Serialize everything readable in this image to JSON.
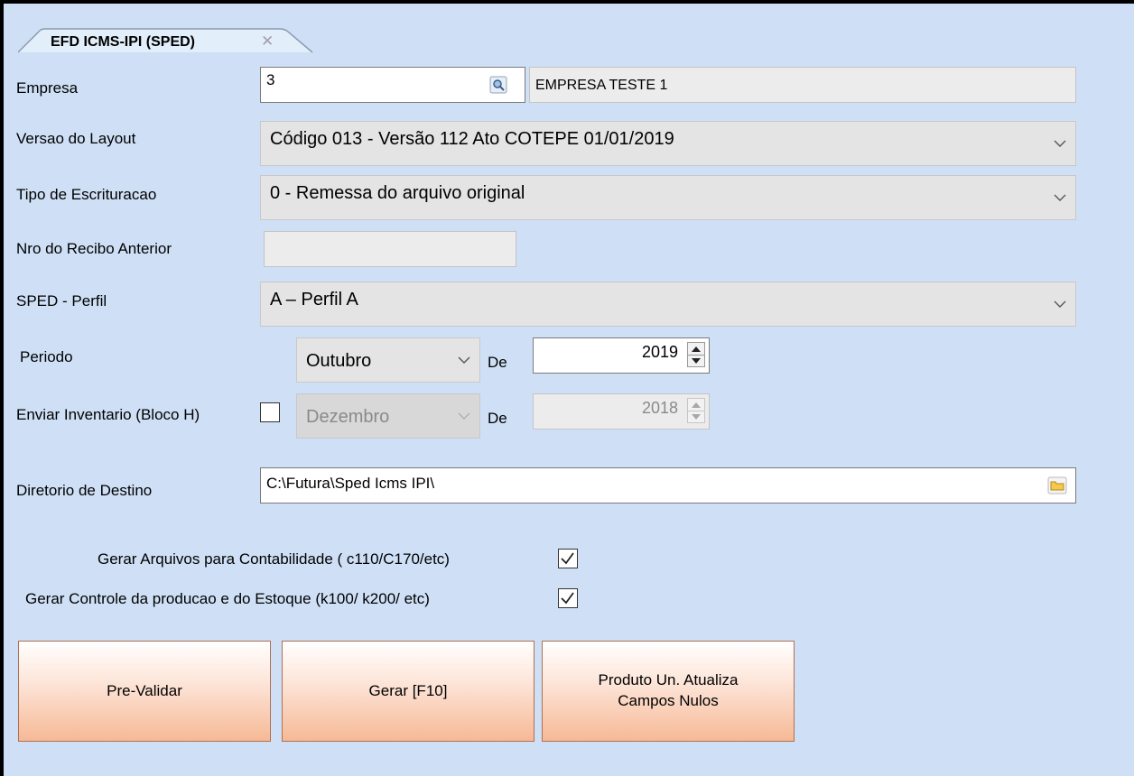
{
  "tab": {
    "title": "EFD ICMS-IPI (SPED)",
    "close": "✕"
  },
  "form": {
    "empresa": {
      "label": "Empresa",
      "code": "3",
      "name": "EMPRESA TESTE 1"
    },
    "versao_layout": {
      "label": "Versao do Layout",
      "value": "Código 013 - Versão 112 Ato COTEPE 01/01/2019"
    },
    "tipo_escrituracao": {
      "label": "Tipo de Escrituracao",
      "value": "0 - Remessa do arquivo original"
    },
    "nro_recibo": {
      "label": "Nro do Recibo Anterior",
      "value": ""
    },
    "sped_perfil": {
      "label": "SPED - Perfil",
      "value": "A – Perfil A"
    },
    "periodo": {
      "label": "Periodo",
      "month": "Outubro",
      "de_label": "De",
      "year": "2019"
    },
    "inventario": {
      "label": "Enviar Inventario (Bloco H)",
      "checked": false,
      "month": "Dezembro",
      "de_label": "De",
      "year": "2018"
    },
    "diretorio": {
      "label": "Diretorio de Destino",
      "value": "C:\\Futura\\Sped Icms IPI\\"
    },
    "gerar_contabilidade": {
      "label": "Gerar Arquivos para Contabilidade ( c110/C170/etc)",
      "checked": true
    },
    "gerar_controle": {
      "label": "Gerar Controle da producao e do Estoque (k100/ k200/ etc)",
      "checked": true
    }
  },
  "buttons": {
    "pre_validar": "Pre-Validar",
    "gerar": "Gerar [F10]",
    "produto_line1": "Produto Un. Atualiza",
    "produto_line2": "Campos Nulos"
  },
  "colors": {
    "panel_bg": "#cfe0f6",
    "button_gradient_end": "#f6b996"
  },
  "icons": [
    "search-icon",
    "chevron-down-icon",
    "spin-up-icon",
    "spin-down-icon",
    "folder-icon",
    "close-icon",
    "check-icon"
  ]
}
